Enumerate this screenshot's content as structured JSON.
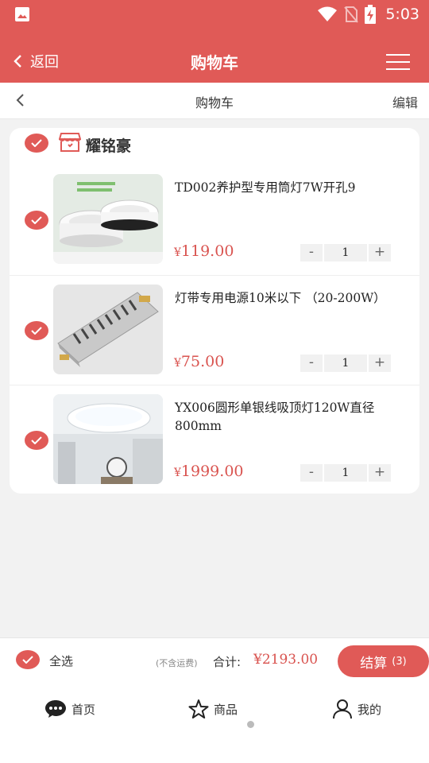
{
  "status_bar": {
    "time": "5:03"
  },
  "header": {
    "back_label": "返回",
    "title": "购物车"
  },
  "subheader": {
    "title": "购物车",
    "edit_label": "编辑"
  },
  "shop": {
    "name": "耀铭豪"
  },
  "items": [
    {
      "name": "TD002养护型专用筒灯7W开孔9",
      "currency": "¥",
      "price": "119.00",
      "qty": "1"
    },
    {
      "name": "灯带专用电源10米以下 （20-200W）",
      "currency": "¥",
      "price": "75.00",
      "qty": "1"
    },
    {
      "name": "YX006圆形单银线吸顶灯120W直径800mm",
      "currency": "¥",
      "price": "1999.00",
      "qty": "1"
    }
  ],
  "stepper": {
    "minus": "-",
    "plus": "+"
  },
  "checkout": {
    "select_all_label": "全选",
    "shipping_note": "(不含运费)",
    "total_label": "合计:",
    "total": "¥2193.00",
    "settle_label": "结算",
    "settle_count": "(3)"
  },
  "tabs": [
    {
      "label": "首页",
      "icon": "chat-bubble-icon"
    },
    {
      "label": "商品",
      "icon": "star-icon"
    },
    {
      "label": "我的",
      "icon": "user-icon"
    }
  ],
  "colors": {
    "accent": "#e05a57",
    "price": "#d9534f",
    "background": "#f2f2f2"
  }
}
